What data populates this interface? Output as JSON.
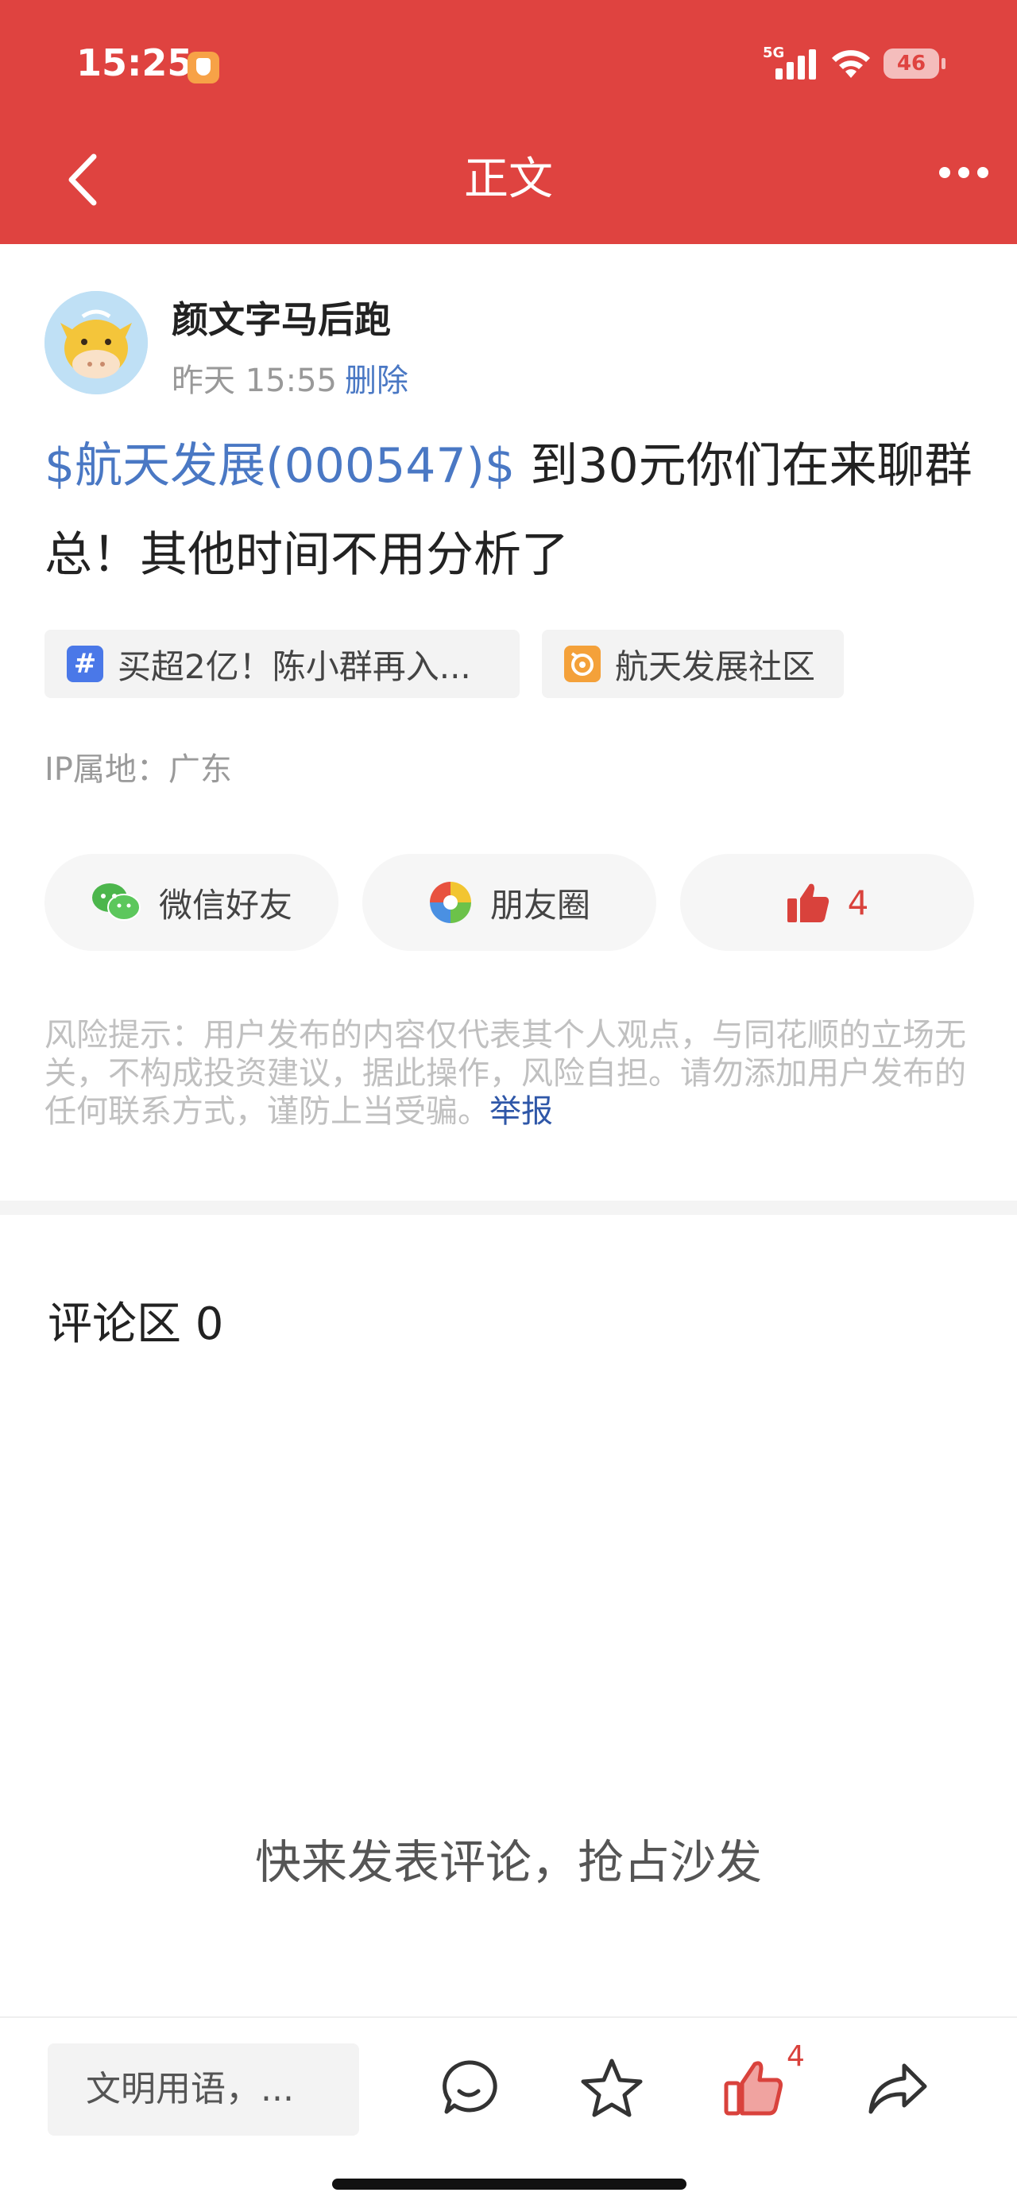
{
  "status_bar": {
    "time": "15:25",
    "network": "5G",
    "battery": "46"
  },
  "nav": {
    "title": "正文"
  },
  "author": {
    "name": "颜文字马后跑",
    "time": "昨天 15:55",
    "delete_label": "删除"
  },
  "post": {
    "stock_tag": "$航天发展(000547)$",
    "text": " 到30元你们在来聊群总！其他时间不用分析了"
  },
  "tags": [
    {
      "label": "买超2亿！陈小群再入...",
      "icon": "hashtag-icon",
      "color": "#4a78e8"
    },
    {
      "label": "航天发展社区",
      "icon": "community-icon",
      "color": "#f4a13a"
    }
  ],
  "ip": {
    "label": "IP属地：广东"
  },
  "share": {
    "wechat": "微信好友",
    "moments": "朋友圈",
    "likes": "4"
  },
  "risk": {
    "text": "风险提示：用户发布的内容仅代表其个人观点，与同花顺的立场无关，不构成投资建议，据此操作，风险自担。请勿添加用户发布的任何联系方式，谨防上当受骗。",
    "report_label": "举报"
  },
  "comments": {
    "title": "评论区 0",
    "empty_text": "快来发表评论，抢占沙发"
  },
  "bottom_bar": {
    "input_placeholder": "文明用语，...",
    "like_count": "4"
  },
  "colors": {
    "header": "#df4340",
    "link": "#4a78c4",
    "like": "#d9423c"
  }
}
